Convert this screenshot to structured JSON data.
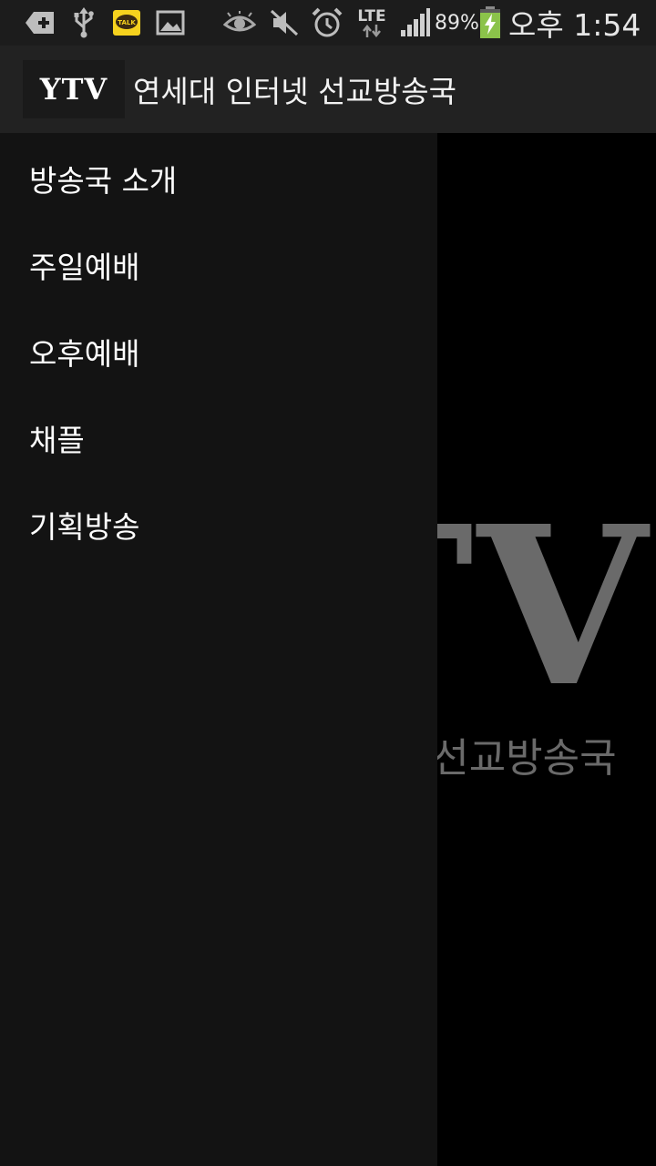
{
  "status_bar": {
    "battery_percent": "89%",
    "network": "LTE",
    "time": "오후 1:54",
    "icons": [
      "sim-add-icon",
      "usb-icon",
      "kakaotalk-icon",
      "gallery-icon",
      "eye-icon",
      "mute-icon",
      "alarm-icon",
      "lte-icon",
      "signal-icon",
      "battery-charging-icon"
    ]
  },
  "app_bar": {
    "logo": "YTV",
    "title": "연세대 인터넷 선교방송국"
  },
  "drawer": {
    "items": [
      {
        "label": "방송국 소개"
      },
      {
        "label": "주일예배"
      },
      {
        "label": "오후예배"
      },
      {
        "label": "채플"
      },
      {
        "label": "기획방송"
      }
    ]
  },
  "background": {
    "logo": "YTV",
    "subtitle": "연세대 인터넷 선교방송국"
  },
  "colors": {
    "status_bar_bg": "#1c1c1c",
    "action_bar_bg": "#222222",
    "drawer_bg": "#131313",
    "content_bg": "#000000",
    "background_logo": "#6a6a6a",
    "battery_fill": "#8bc34a",
    "kakaotalk_yellow": "#f6d21e"
  }
}
